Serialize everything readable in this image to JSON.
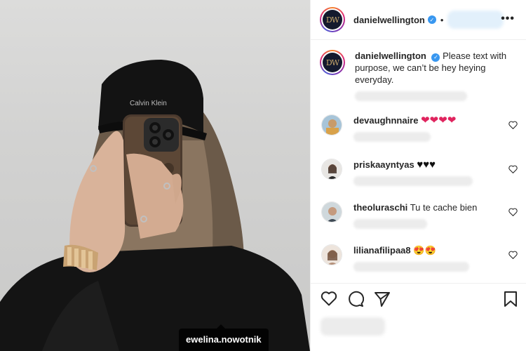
{
  "photo": {
    "tagged_user": "ewelina.nowotnik",
    "cap_text": "Calvin Klein"
  },
  "post": {
    "author": "danielwellington",
    "logo_letters": "DW",
    "caption": "Please text with purpose, we can’t be hey heying everyday.",
    "header_separator": "•"
  },
  "comments": [
    {
      "user": "devaughnnaire",
      "text": "",
      "emoji": [
        "❤",
        "❤",
        "❤",
        "❤"
      ],
      "emoji_style": "red-heart"
    },
    {
      "user": "priskaayntyas",
      "text": "",
      "emoji": [
        "♥",
        "♥",
        "♥"
      ],
      "emoji_style": "black-heart"
    },
    {
      "user": "theoluraschi",
      "text": "Tu te cache bien",
      "emoji": [],
      "emoji_style": ""
    },
    {
      "user": "lilianafilipaa8",
      "text": "",
      "emoji": [
        "😍",
        "😍"
      ],
      "emoji_style": "heart-eyes"
    }
  ],
  "icons": {
    "more": "more-options-icon",
    "like": "heart-outline-icon",
    "comment": "comment-bubble-icon",
    "share": "paper-plane-icon",
    "save": "bookmark-icon",
    "verified": "verified-badge-icon"
  },
  "colors": {
    "verified_blue": "#3897f0",
    "ring_start": "#f58529",
    "ring_mid": "#dd2a7b",
    "ring_end": "#8134af",
    "heart_red": "#e0245e"
  }
}
